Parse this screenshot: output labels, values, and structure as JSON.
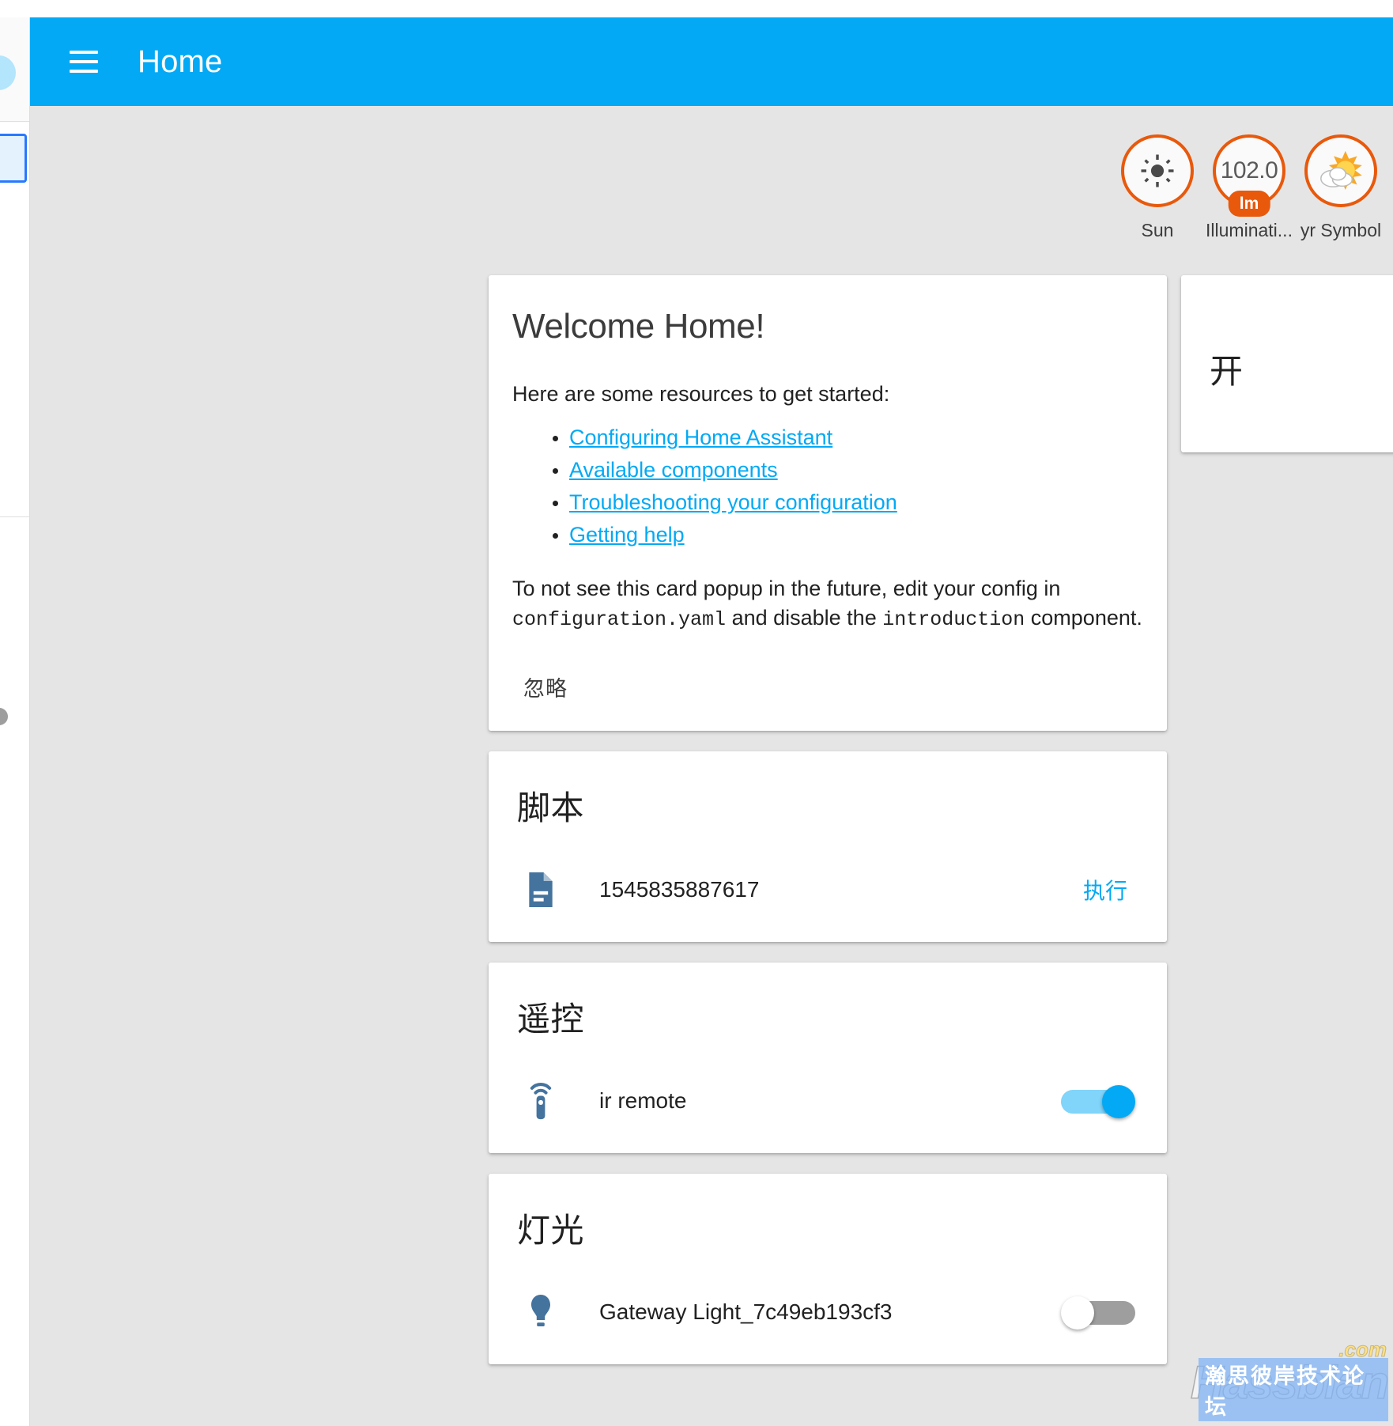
{
  "app": {
    "title": "Home",
    "menu_icon": "hamburger-menu-icon"
  },
  "theme": {
    "primary": "#03a9f4",
    "badge_accent": "#e8590c",
    "background": "#e5e5e5",
    "card": "#ffffff",
    "link": "#03a9f4",
    "entity_icon": "#44739e"
  },
  "badges": [
    {
      "id": "sun",
      "label": "Sun",
      "value": "",
      "unit": "",
      "icon": "sun-icon"
    },
    {
      "id": "illuminance",
      "label": "Illuminati...",
      "value": "102.0",
      "unit": "lm",
      "icon": "value-badge"
    },
    {
      "id": "yr-symbol",
      "label": "yr Symbol",
      "value": "",
      "unit": "",
      "icon": "sun-behind-cloud-icon"
    }
  ],
  "welcome_card": {
    "title": "Welcome Home!",
    "intro": "Here are some resources to get started:",
    "links": [
      "Configuring Home Assistant",
      "Available components",
      "Troubleshooting your configuration",
      "Getting help"
    ],
    "footer_part1": "To not see this card popup in the future, edit your config in",
    "footer_code1": "configuration.yaml",
    "footer_part2": "and disable the",
    "footer_code2": "introduction",
    "footer_part3": "component.",
    "dismiss_label": "忽略"
  },
  "cards": [
    {
      "id": "scripts",
      "header": "脚本",
      "rows": [
        {
          "name": "1545835887617",
          "icon": "script-file-icon",
          "control": "action",
          "action_label": "执行"
        }
      ]
    },
    {
      "id": "remote",
      "header": "遥控",
      "rows": [
        {
          "name": "ir remote",
          "icon": "remote-control-icon",
          "control": "toggle",
          "toggle_state": "on"
        }
      ]
    },
    {
      "id": "lights",
      "header": "灯光",
      "rows": [
        {
          "name": "Gateway Light_7c49eb193cf3",
          "icon": "lightbulb-icon",
          "control": "toggle",
          "toggle_state": "off"
        }
      ]
    }
  ],
  "side_card": {
    "header": "开"
  },
  "watermark": {
    "main": "Hassbian",
    "tld": ".com",
    "subtitle": "瀚思彼岸技术论坛"
  }
}
